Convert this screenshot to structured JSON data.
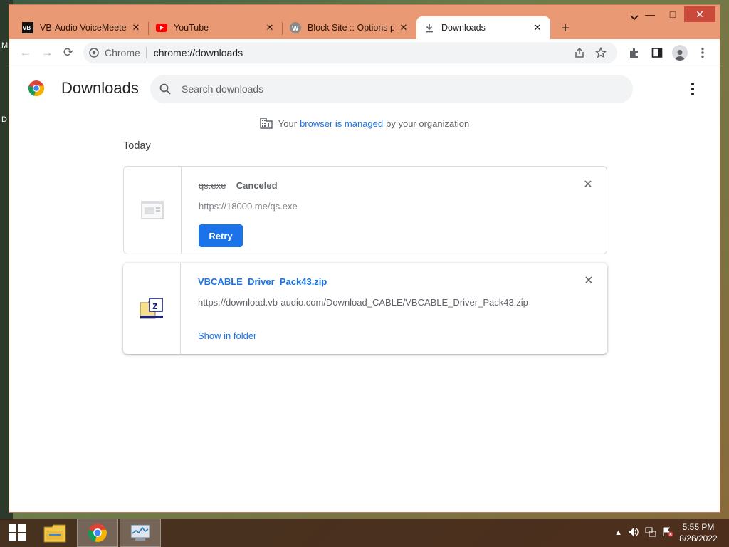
{
  "desktop": {
    "edge_text_1": "M",
    "edge_text_2": "D"
  },
  "tabs": [
    {
      "title": "VB-Audio VoiceMeeter",
      "icon": "vb-audio-icon",
      "active": false
    },
    {
      "title": "YouTube",
      "icon": "youtube-icon",
      "active": false
    },
    {
      "title": "Block Site :: Options page",
      "icon": "block-site-icon",
      "active": false
    },
    {
      "title": "Downloads",
      "icon": "download-icon",
      "active": true
    }
  ],
  "toolbar": {
    "chip_label": "Chrome",
    "url": "chrome://downloads"
  },
  "page": {
    "title": "Downloads",
    "search_placeholder": "Search downloads",
    "managed": {
      "prefix": "Your",
      "link": "browser is managed",
      "suffix": "by your organization"
    },
    "section_label": "Today",
    "downloads": [
      {
        "file_name": "qs.exe",
        "status": "Canceled",
        "url": "https://18000.me/qs.exe",
        "action_label": "Retry"
      },
      {
        "file_name": "VBCABLE_Driver_Pack43.zip",
        "status": "",
        "url": "https://download.vb-audio.com/Download_CABLE/VBCABLE_Driver_Pack43.zip",
        "action_label": "Show in folder"
      }
    ]
  },
  "taskbar": {
    "time": "5:55 PM",
    "date": "8/26/2022"
  },
  "colors": {
    "accent": "#1a73e8",
    "frame": "#e99a74",
    "close": "#c94a3a"
  }
}
